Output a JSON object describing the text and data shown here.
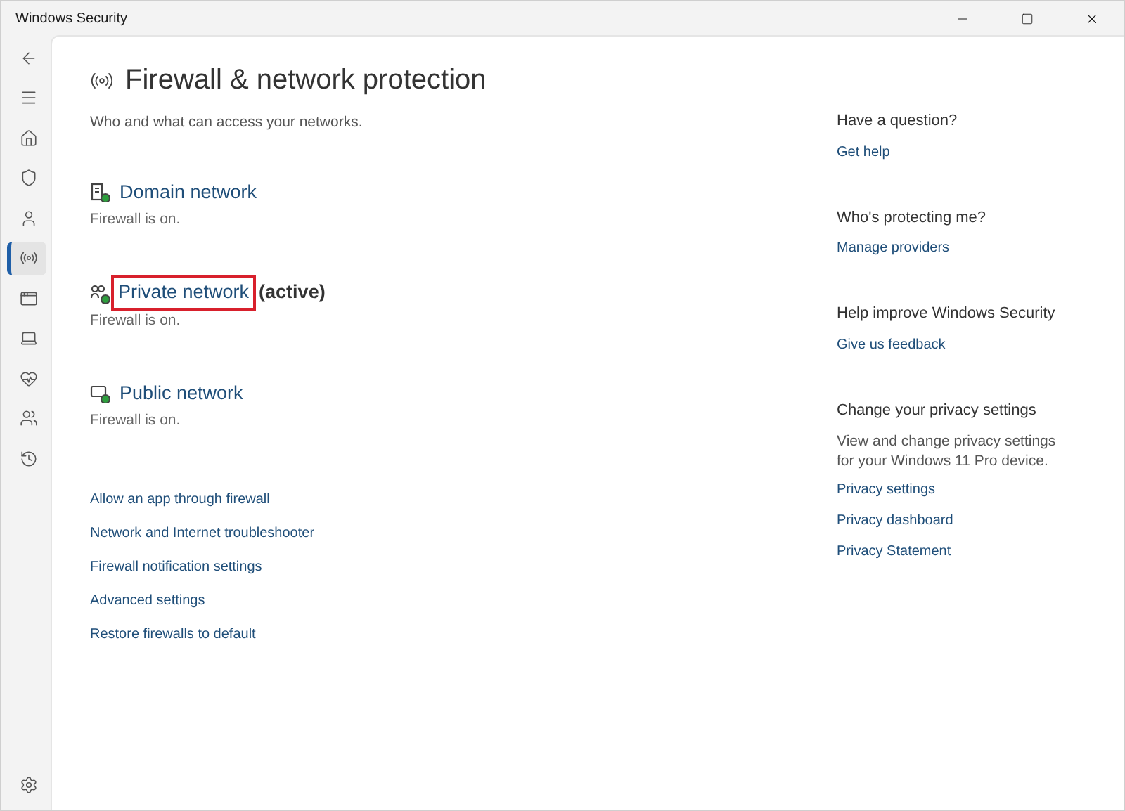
{
  "window": {
    "title": "Windows Security"
  },
  "sidebar": {
    "items": [
      {
        "kind": "back",
        "selected": false
      },
      {
        "kind": "menu",
        "selected": false
      },
      {
        "kind": "home",
        "selected": false
      },
      {
        "kind": "shield",
        "selected": false
      },
      {
        "kind": "account",
        "selected": false
      },
      {
        "kind": "network",
        "selected": true
      },
      {
        "kind": "app",
        "selected": false
      },
      {
        "kind": "device",
        "selected": false
      },
      {
        "kind": "health",
        "selected": false
      },
      {
        "kind": "family",
        "selected": false
      },
      {
        "kind": "history",
        "selected": false
      }
    ],
    "footer": {
      "kind": "settings",
      "selected": false
    }
  },
  "page": {
    "title": "Firewall & network protection",
    "subtitle": "Who and what can access your networks.",
    "networks": [
      {
        "kind": "domain",
        "name": "Domain network",
        "status": "Firewall is on.",
        "highlighted": false
      },
      {
        "kind": "private",
        "name": "Private network",
        "suffix": "(active)",
        "status": "Firewall is on.",
        "highlighted": true
      },
      {
        "kind": "public",
        "name": "Public network",
        "status": "Firewall is on.",
        "highlighted": false
      }
    ],
    "links": [
      "Allow an app through firewall",
      "Network and Internet troubleshooter",
      "Firewall notification settings",
      "Advanced settings",
      "Restore firewalls to default"
    ]
  },
  "side_panel": [
    {
      "heading": "Have a question?",
      "links": [
        "Get help"
      ]
    },
    {
      "heading": "Who's protecting me?",
      "links": [
        "Manage providers"
      ]
    },
    {
      "heading": "Help improve Windows Security",
      "links": [
        "Give us feedback"
      ]
    },
    {
      "heading": "Change your privacy settings",
      "text": "View and change privacy settings for your Windows 11 Pro device.",
      "links": [
        "Privacy settings",
        "Privacy dashboard",
        "Privacy Statement"
      ]
    }
  ]
}
